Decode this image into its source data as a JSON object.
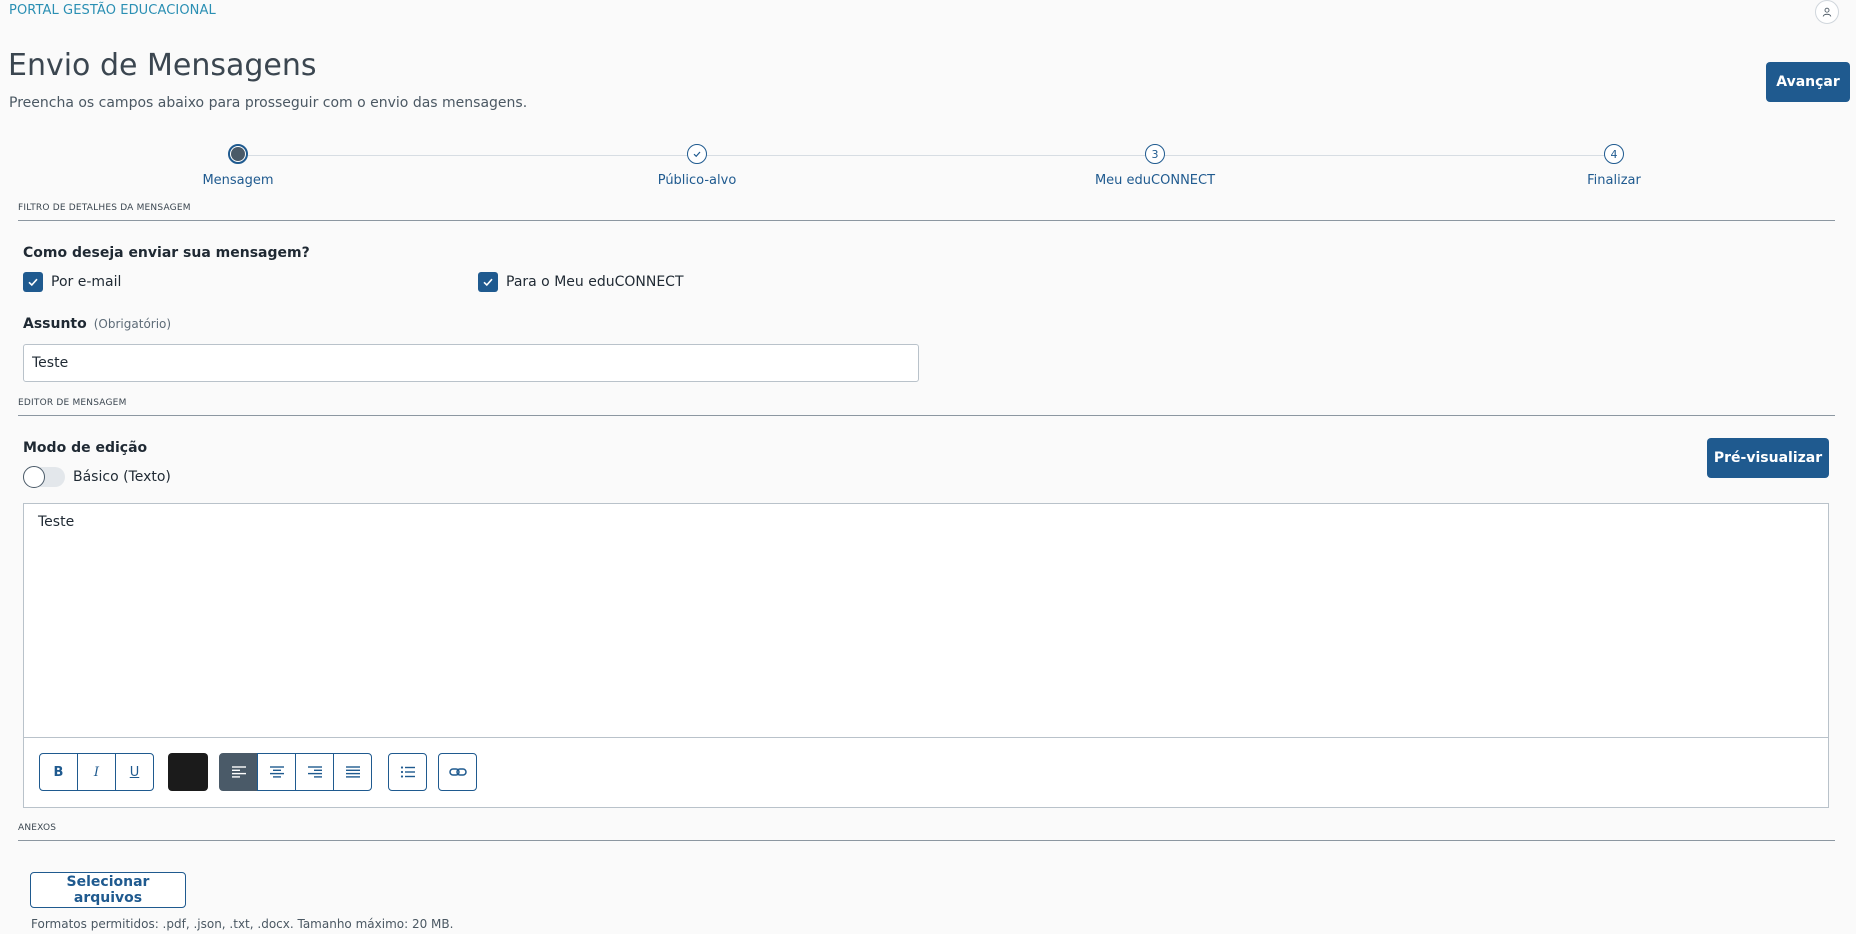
{
  "header": {
    "portal_title": "PORTAL GESTÃO EDUCACIONAL",
    "user_icon": "user-icon"
  },
  "page": {
    "title": "Envio de Mensagens",
    "subtitle": "Preencha os campos abaixo para prosseguir com o envio das mensagens.",
    "next_button": "Avançar"
  },
  "stepper": {
    "steps": [
      {
        "label": "Mensagem",
        "marker": "",
        "state": "active"
      },
      {
        "label": "Público-alvo",
        "marker": "check",
        "state": "done"
      },
      {
        "label": "Meu eduCONNECT",
        "marker": "3",
        "state": "pending"
      },
      {
        "label": "Finalizar",
        "marker": "4",
        "state": "pending"
      }
    ]
  },
  "filter_section": {
    "label": "FILTRO DE DETALHES DA MENSAGEM",
    "question": "Como deseja enviar sua mensagem?",
    "options": [
      {
        "label": "Por e-mail",
        "checked": true
      },
      {
        "label": "Para o Meu eduCONNECT",
        "checked": true
      }
    ],
    "subject_label": "Assunto",
    "subject_hint": "(Obrigatório)",
    "subject_value": "Teste"
  },
  "editor_section": {
    "label": "EDITOR DE MENSAGEM",
    "mode_label": "Modo de edição",
    "toggle_label": "Básico (Texto)",
    "toggle_on": false,
    "preview_button": "Pré-visualizar",
    "content": "Teste",
    "toolbar": {
      "bold": "B",
      "italic": "I",
      "underline": "U",
      "text_color": "#1b1b1b",
      "align_active": "left"
    }
  },
  "attachments_section": {
    "label": "ANEXOS",
    "select_button": "Selecionar arquivos",
    "hint": "Formatos permitidos: .pdf, .json, .txt, .docx. Tamanho máximo: 20 MB."
  },
  "colors": {
    "primary": "#1f5a8f",
    "header_accent": "#2a8fb3",
    "active_tool": "#4a5a68"
  }
}
